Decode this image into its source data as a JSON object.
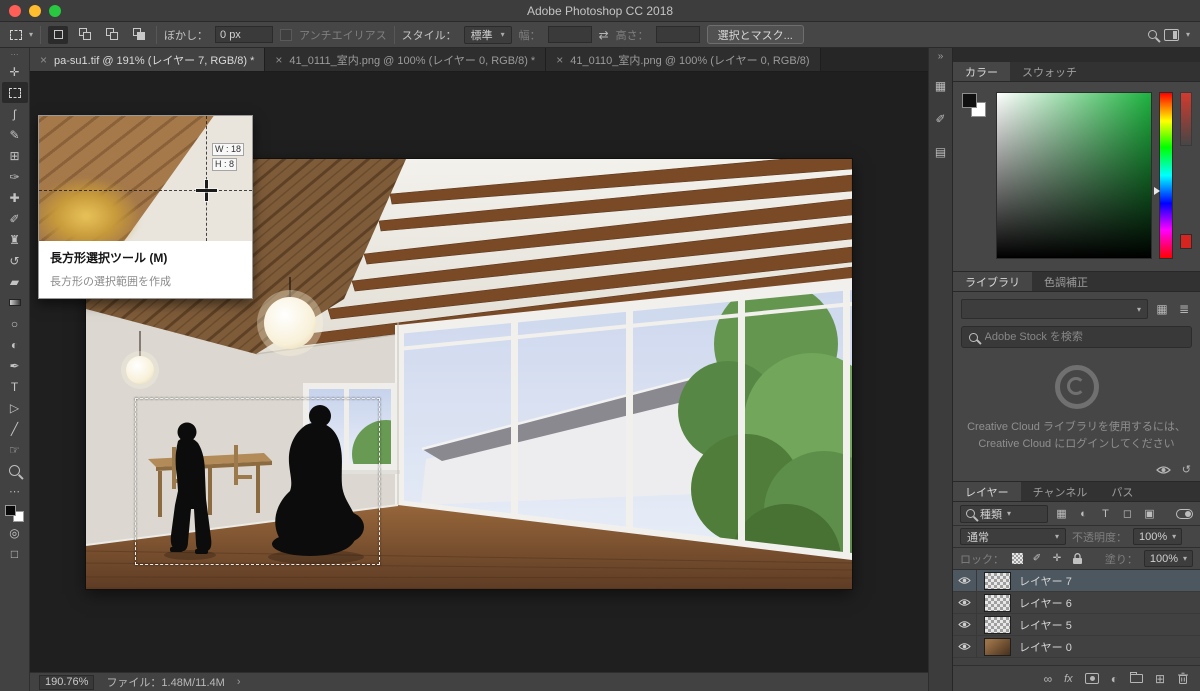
{
  "window": {
    "title": "Adobe Photoshop CC 2018"
  },
  "colors": {
    "traffic_red": "#ff5f57",
    "traffic_yellow": "#febc2e",
    "traffic_green": "#28c840",
    "picker_green": "#1db33f",
    "selected_layer_row": "#4d5760"
  },
  "icons": {
    "dropdown_arrow": "▾",
    "swap_dimensions": "⇄",
    "close_tab": "×",
    "panel_collapse": "»",
    "toolbar_grip": "⋯",
    "ellipsis": "⋯",
    "chevron_right": "›",
    "link": "∞",
    "fx": "fx",
    "adjustment": "◐",
    "new_item": "⊞",
    "grid_view": "▦",
    "list_view": "≣",
    "filter_pixel": "▦",
    "filter_adjustment": "◐",
    "filter_type": "T",
    "filter_shape": "◻",
    "filter_smart": "▣",
    "lock_pixels": "✐",
    "lock_position": "✛",
    "sync": "↺"
  },
  "options_bar": {
    "feather_label": "ぼかし：",
    "feather_value": "0 px",
    "antialias_label": "アンチエイリアス",
    "style_label": "スタイル：",
    "style_value": "標準",
    "width_label": "幅：",
    "width_value": "",
    "height_label": "高さ：",
    "height_value": "",
    "select_and_mask_label": "選択とマスク..."
  },
  "document_tabs": [
    {
      "label": "pa-su1.tif @ 191% (レイヤー 7, RGB/8) *",
      "active": true
    },
    {
      "label": "41_0111_室内.png @ 100% (レイヤー 0, RGB/8) *",
      "active": false
    },
    {
      "label": "41_0110_室内.png @ 100% (レイヤー 0, RGB/8)",
      "active": false
    }
  ],
  "toolbar": {
    "tools": [
      {
        "name": "move-tool",
        "glyph": "✛"
      },
      {
        "name": "rectangular-marquee-tool",
        "glyph": "",
        "active": true
      },
      {
        "name": "lasso-tool",
        "glyph": "ʃ"
      },
      {
        "name": "quick-selection-tool",
        "glyph": "✎"
      },
      {
        "name": "crop-tool",
        "glyph": "⊞"
      },
      {
        "name": "eyedropper-tool",
        "glyph": "✑"
      },
      {
        "name": "spot-healing-brush-tool",
        "glyph": "✚"
      },
      {
        "name": "brush-tool",
        "glyph": "✐"
      },
      {
        "name": "clone-stamp-tool",
        "glyph": "♜"
      },
      {
        "name": "history-brush-tool",
        "glyph": "↺"
      },
      {
        "name": "eraser-tool",
        "glyph": "▰"
      },
      {
        "name": "gradient-tool",
        "glyph": ""
      },
      {
        "name": "blur-tool",
        "glyph": "○"
      },
      {
        "name": "dodge-tool",
        "glyph": "◐"
      },
      {
        "name": "pen-tool",
        "glyph": "✒"
      },
      {
        "name": "type-tool",
        "glyph": "T"
      },
      {
        "name": "path-selection-tool",
        "glyph": "▷"
      },
      {
        "name": "rectangle-tool",
        "glyph": "╱"
      },
      {
        "name": "hand-tool",
        "glyph": "☞"
      },
      {
        "name": "zoom-tool",
        "glyph": ""
      }
    ]
  },
  "tooltip": {
    "width_readout": "W : 18",
    "height_readout": "H : 8",
    "title": "長方形選択ツール (M)",
    "description": "長方形の選択範囲を作成"
  },
  "rail": {
    "icons": [
      {
        "name": "collapsed-panel-icon-1",
        "glyph": "▦"
      },
      {
        "name": "collapsed-panel-icon-2",
        "glyph": "✐"
      },
      {
        "name": "collapsed-panel-icon-3",
        "glyph": "▤"
      }
    ]
  },
  "color_panel": {
    "tabs": [
      {
        "label": "カラー",
        "active": true
      },
      {
        "label": "スウォッチ",
        "active": false
      }
    ]
  },
  "library_panel": {
    "tabs": [
      {
        "label": "ライブラリ",
        "active": true
      },
      {
        "label": "色調補正",
        "active": false
      }
    ],
    "search_placeholder": "Adobe Stock を検索",
    "message_line1": "Creative Cloud ライブラリを使用するには、",
    "message_line2": "Creative Cloud にログインしてください"
  },
  "layers_panel": {
    "tabs": [
      {
        "label": "レイヤー",
        "active": true
      },
      {
        "label": "チャンネル",
        "active": false
      },
      {
        "label": "パス",
        "active": false
      }
    ],
    "kind_label": "種類",
    "blend_mode": "通常",
    "opacity_label": "不透明度：",
    "opacity_value": "100%",
    "lock_label": "ロック：",
    "fill_label": "塗り：",
    "fill_value": "100%",
    "rows": [
      {
        "name": "レイヤー 7",
        "selected": true
      },
      {
        "name": "レイヤー 6",
        "selected": false
      },
      {
        "name": "レイヤー 5",
        "selected": false
      },
      {
        "name": "レイヤー 0",
        "selected": false
      }
    ]
  },
  "status_bar": {
    "zoom": "190.76%",
    "file_info": "ファイル：1.48M/11.4M"
  }
}
